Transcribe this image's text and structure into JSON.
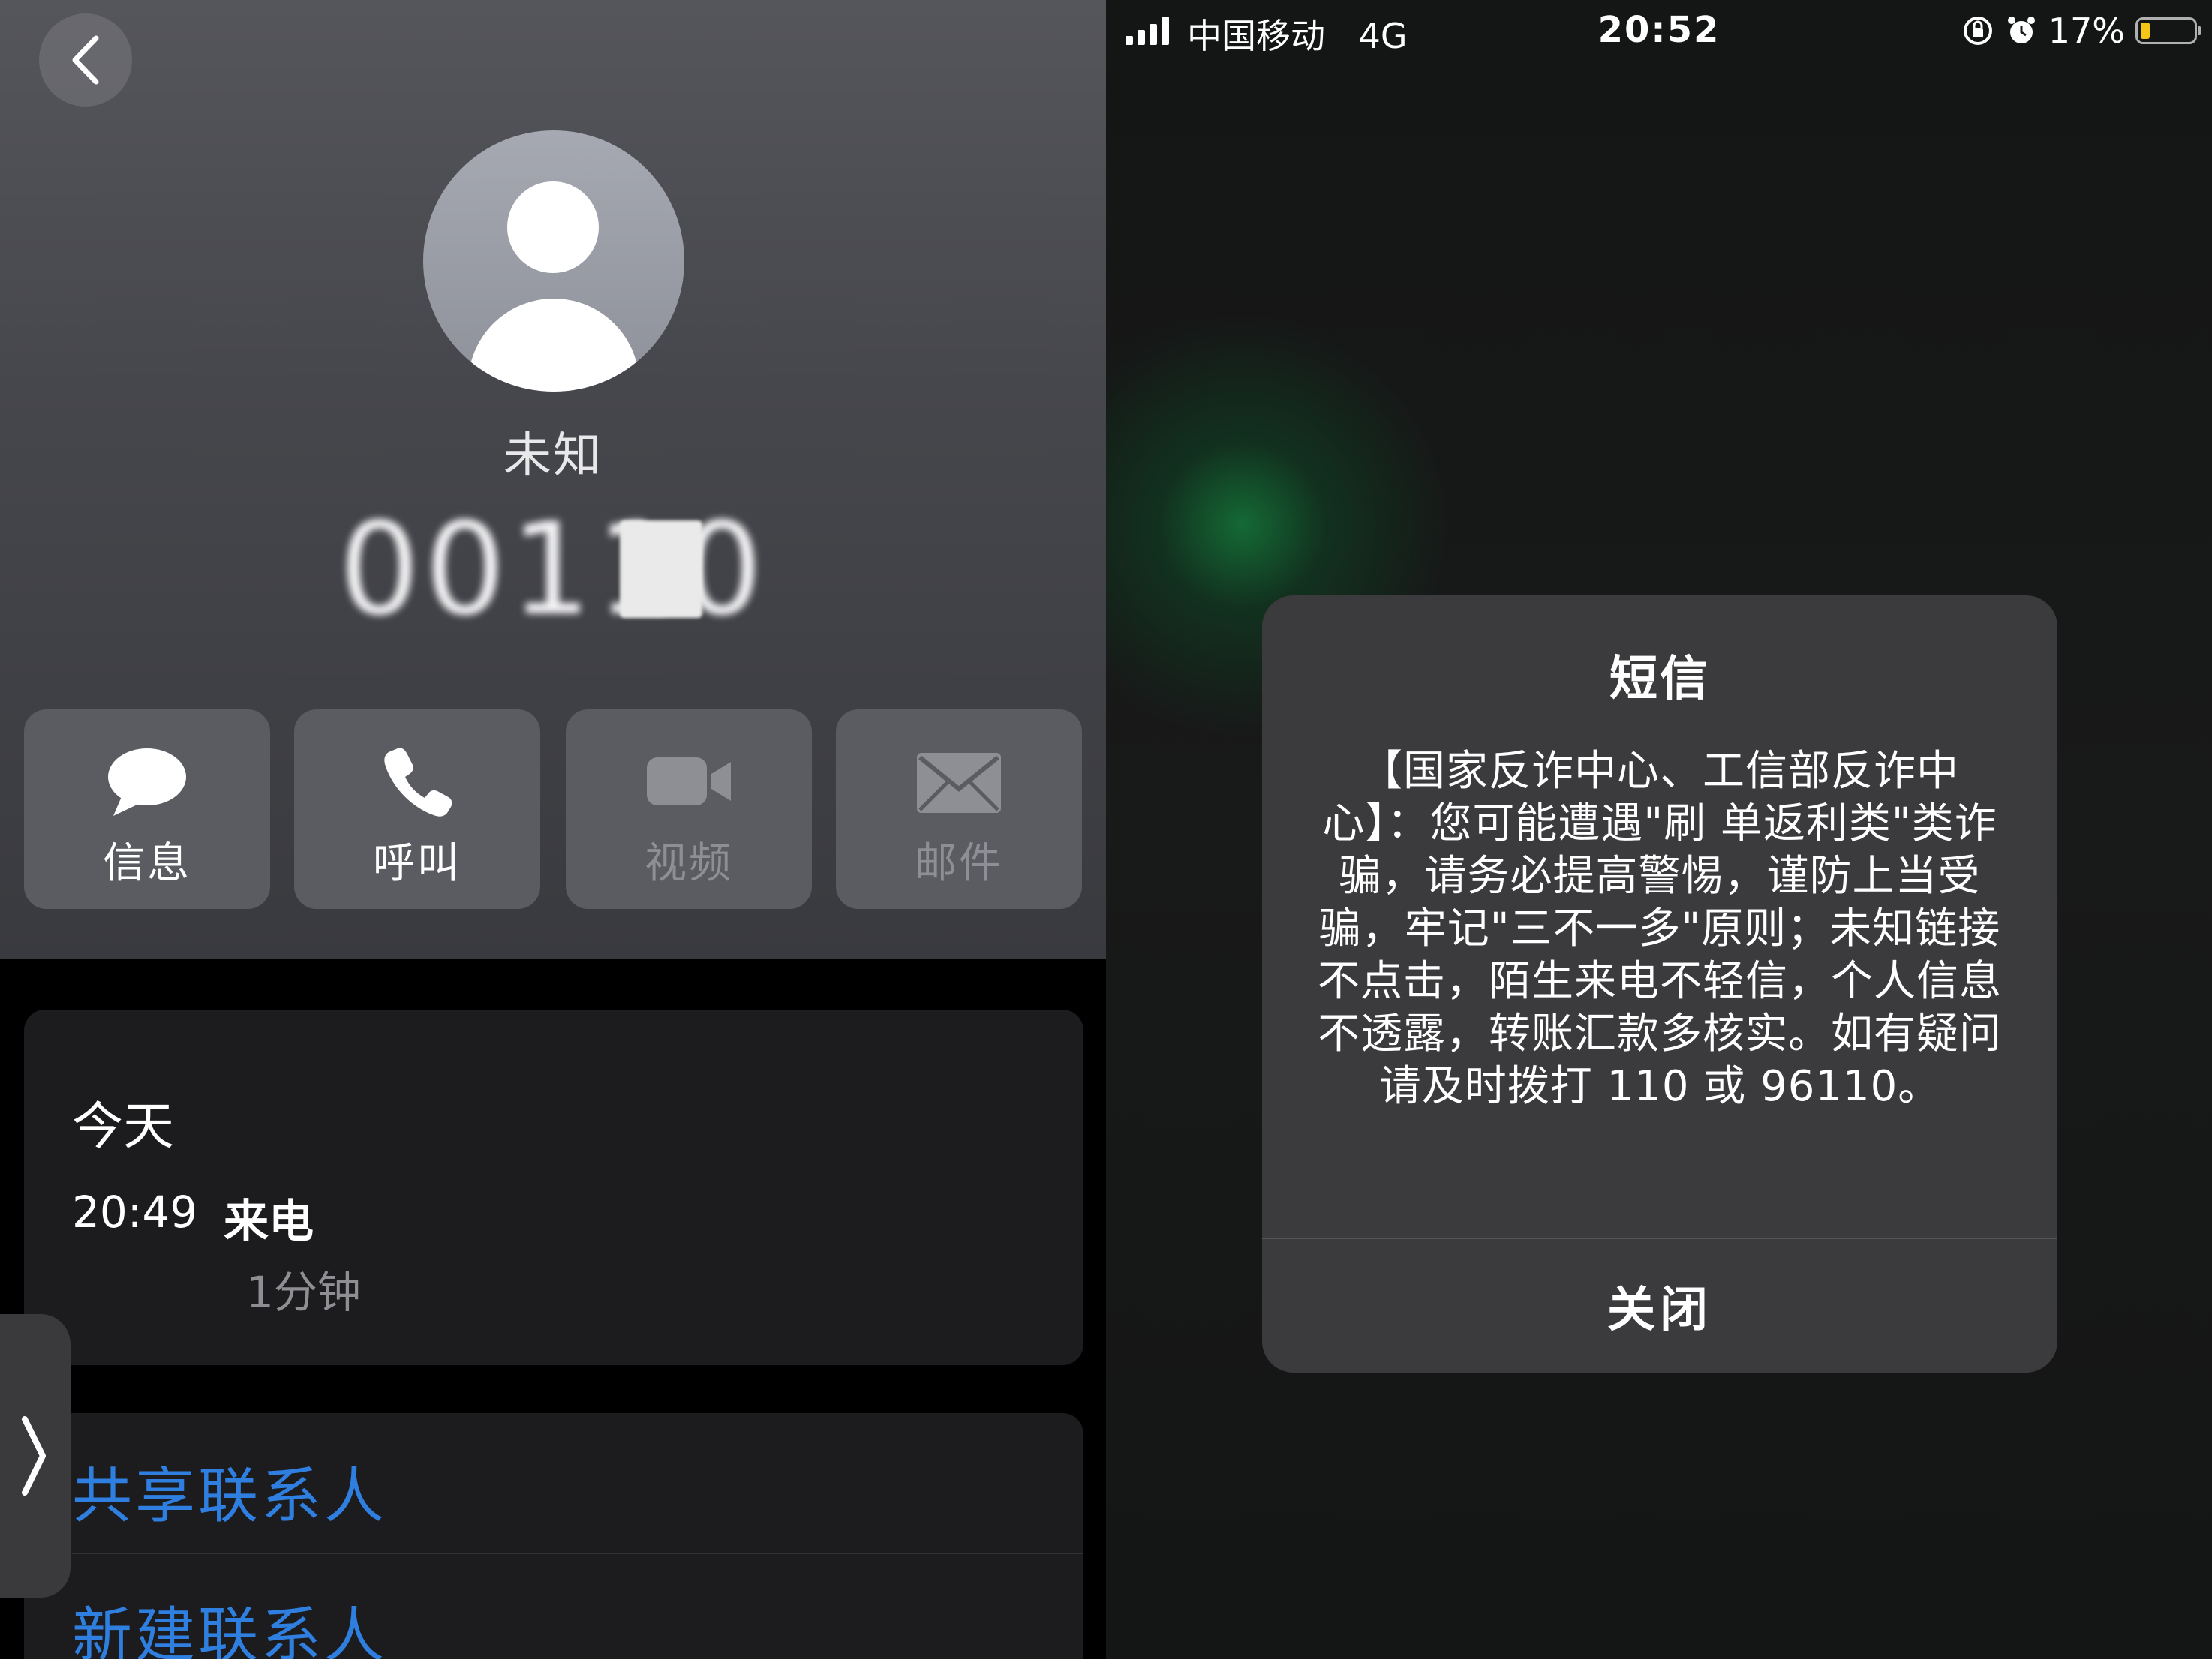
{
  "left_panel": {
    "contact": {
      "name": "未知",
      "number": "00110"
    },
    "actions": [
      {
        "label": "信息",
        "icon": "message-bubble-icon",
        "enabled": true
      },
      {
        "label": "呼叫",
        "icon": "phone-icon",
        "enabled": true
      },
      {
        "label": "视频",
        "icon": "video-camera-icon",
        "enabled": false
      },
      {
        "label": "邮件",
        "icon": "mail-envelope-icon",
        "enabled": false
      }
    ],
    "recent_call": {
      "day": "今天",
      "time": "20:49",
      "type": "来电",
      "duration": "1分钟"
    },
    "links": [
      "共享联系人",
      "新建联系人"
    ]
  },
  "right_panel": {
    "status_bar": {
      "carrier": "中国移动",
      "network": "4G",
      "time": "20:52",
      "battery": "17%",
      "battery_level": 0.17
    },
    "alert": {
      "title": "短信",
      "body": "【国家反诈中心、工信部反诈中心】：您可能遭遇\"刷 单返利类\"类诈骗，请务必提高警惕，谨防上当受骗，牢记\"三不一多\"原则；未知链接不点击，陌生来电不轻信，个人信息不透露，转账汇款多核实。如有疑问请及时拨打 110 或 96110。",
      "close_label": "关闭"
    }
  },
  "colors": {
    "link_blue": "#2f7fe0",
    "battery_yellow": "#f5c518",
    "card_bg": "#1c1c1e",
    "dialog_bg": "#3b3b3d"
  }
}
